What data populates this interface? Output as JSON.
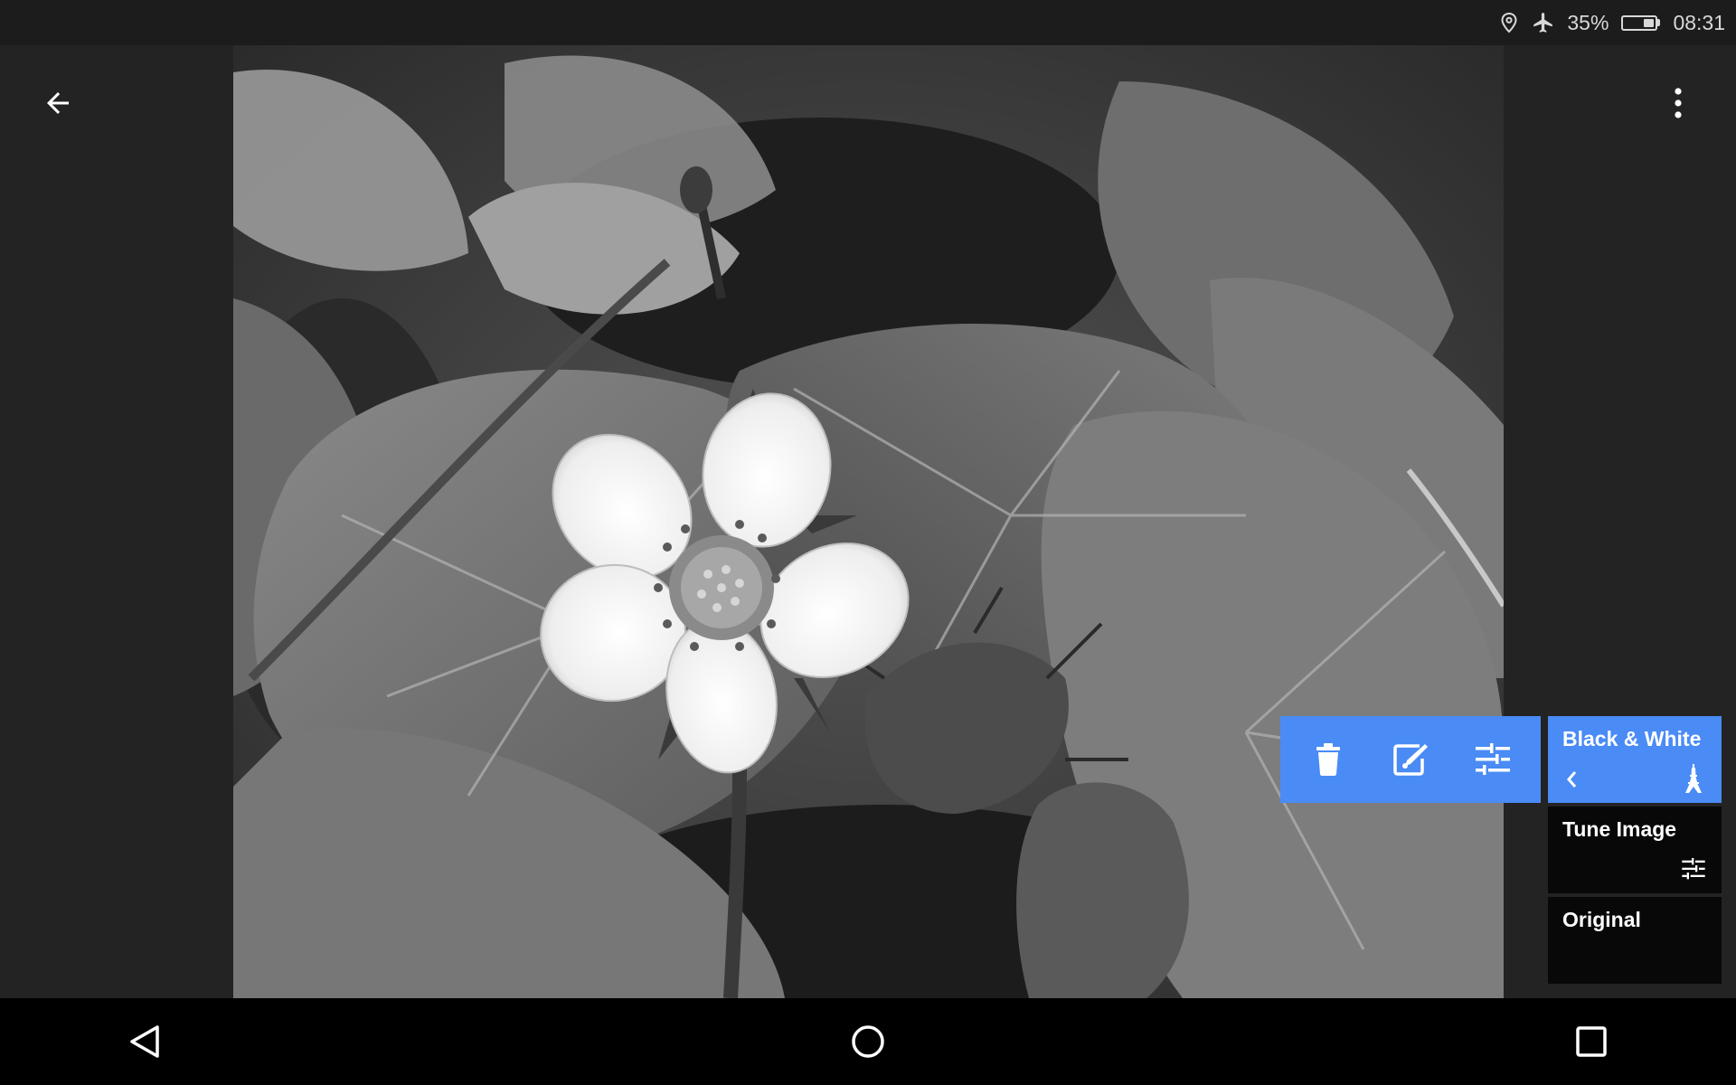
{
  "status_bar": {
    "battery_text": "35%",
    "battery_level": 0.35,
    "time": "08:31",
    "icons": [
      "location-icon",
      "airplane-mode-icon",
      "battery-icon"
    ]
  },
  "toolbar": {
    "back_icon": "arrow-back-icon",
    "overflow_icon": "more-vert-icon"
  },
  "edit_tools": [
    {
      "name": "delete",
      "icon": "trash-icon"
    },
    {
      "name": "edit",
      "icon": "edit-pencil-icon"
    },
    {
      "name": "tune",
      "icon": "sliders-icon"
    }
  ],
  "filters": {
    "black_white": {
      "label": "Black & White",
      "icon": "eiffel-tower-icon",
      "selected": true
    },
    "tune_image": {
      "label": "Tune Image",
      "icon": "sliders-icon"
    },
    "original": {
      "label": "Original"
    }
  },
  "nav_bar": {
    "back": "triangle-back-icon",
    "home": "circle-home-icon",
    "recents": "square-recents-icon"
  },
  "colors": {
    "accent": "#4a8bf5",
    "background": "#232323",
    "card": "#080808",
    "nav": "#000000"
  }
}
